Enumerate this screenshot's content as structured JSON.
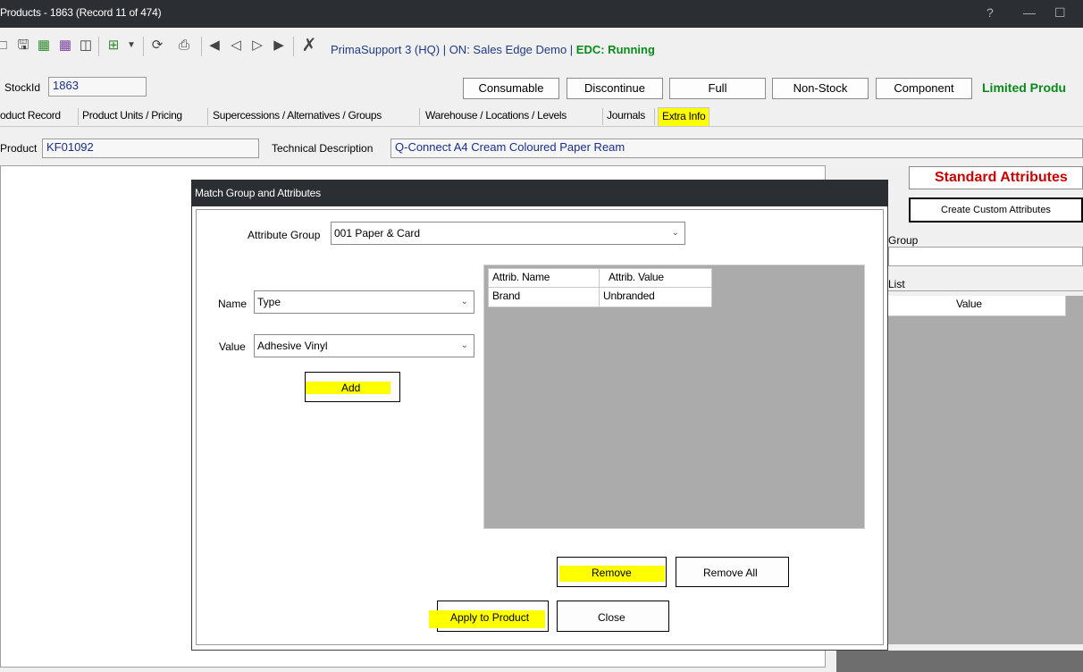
{
  "window": {
    "title": "Products - 1863  (Record 11 of 474)",
    "controls": [
      "?",
      "—",
      "☐"
    ]
  },
  "toolbar": {
    "icons": [
      "checkbox-icon",
      "save-icon",
      "save-new-icon",
      "save-close-icon",
      "delete-icon",
      "new-icon",
      "dropdown-arrow-icon",
      "refresh-icon",
      "attach-icon",
      "first-record-icon",
      "previous-record-icon",
      "next-record-icon",
      "last-record-icon",
      "close-x-icon"
    ],
    "status_prefix": "PrimaSupport 3 (HQ) | ON: Sales Edge Demo | ",
    "status_edc": "EDC: Running"
  },
  "record": {
    "stockid_label": "StockId",
    "stockid_value": "1863",
    "buttons": [
      "Consumable",
      "Discontinue",
      "Full",
      "Non-Stock",
      "Component"
    ],
    "limited_label": "Limited Produ"
  },
  "tabs": [
    "oduct Record",
    "Product Units / Pricing",
    "Supercessions / Alternatives / Groups",
    "Warehouse / Locations / Levels",
    "Journals",
    "Extra Info"
  ],
  "product": {
    "label": "Product",
    "value": "KF01092",
    "tech_label": "Technical Description",
    "tech_value": "Q-Connect A4 Cream Coloured Paper Ream"
  },
  "right_panel": {
    "standard_attributes": "Standard Attributes",
    "create_custom": "Create Custom Attributes",
    "group_label": "Group",
    "list_label": "List",
    "value_header": "Value",
    "accent_color": "#cc0000"
  },
  "dialog": {
    "title": "Match Group and Attributes",
    "attribute_group_label": "Attribute Group",
    "attribute_group_value": "001 Paper & Card",
    "name_label": "Name",
    "name_value": "Type",
    "value_label": "Value",
    "value_value": "Adhesive Vinyl",
    "add_label": "Add",
    "grid": {
      "columns": [
        "Attrib. Name",
        "Attrib. Value"
      ],
      "rows": [
        [
          "Brand",
          "Unbranded"
        ]
      ]
    },
    "remove_label": "Remove",
    "remove_all_label": "Remove All",
    "apply_label": "Apply to Product",
    "close_label": "Close"
  }
}
